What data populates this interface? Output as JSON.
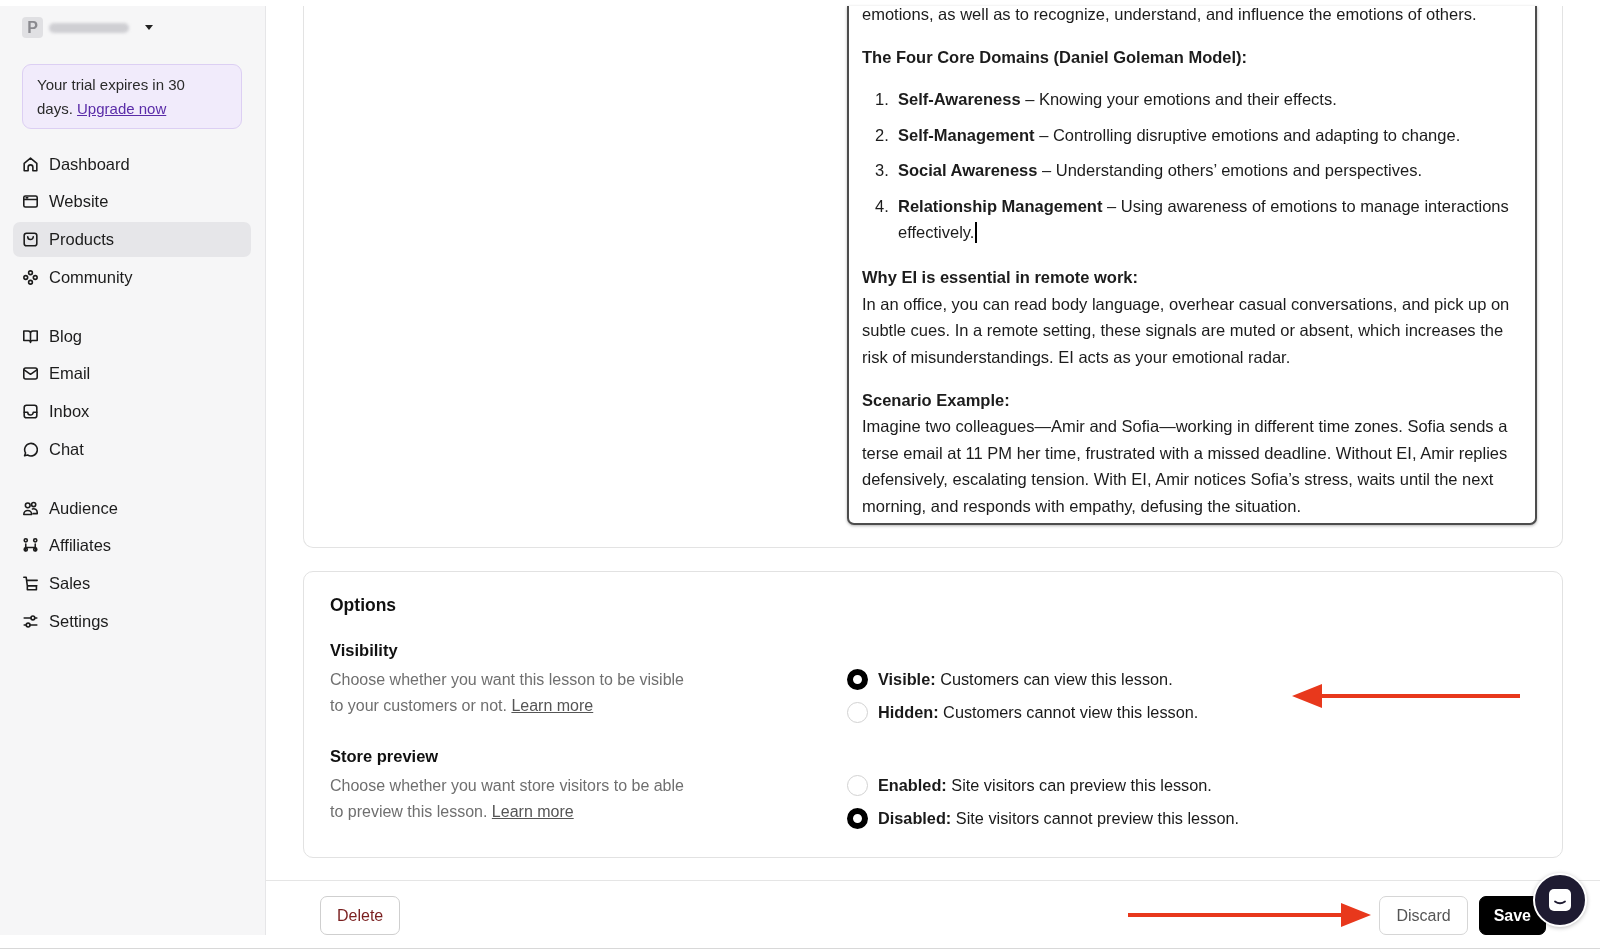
{
  "sidebar": {
    "workspace": {
      "initial": "P"
    },
    "trial_notice": {
      "text": "Your trial expires in 30 days.",
      "link": "Upgrade now"
    },
    "nav_groups": [
      {
        "items": [
          {
            "label": "Dashboard",
            "selected": false
          },
          {
            "label": "Website",
            "selected": false
          },
          {
            "label": "Products",
            "selected": true
          },
          {
            "label": "Community",
            "selected": false
          }
        ]
      },
      {
        "items": [
          {
            "label": "Blog",
            "selected": false
          },
          {
            "label": "Email",
            "selected": false
          },
          {
            "label": "Inbox",
            "selected": false
          },
          {
            "label": "Chat",
            "selected": false
          }
        ]
      },
      {
        "items": [
          {
            "label": "Audience",
            "selected": false
          },
          {
            "label": "Affiliates",
            "selected": false
          },
          {
            "label": "Sales",
            "selected": false
          },
          {
            "label": "Settings",
            "selected": false
          }
        ]
      }
    ]
  },
  "editor": {
    "blocks": [
      {
        "kind": "paragraph",
        "text": "emotions, as well as to recognize, understand, and influence the emotions of others."
      },
      {
        "kind": "heading",
        "text": "The Four Core Domains (Daniel Goleman Model):"
      },
      {
        "kind": "ordered_list",
        "items": [
          {
            "number": "1.",
            "text": "**Self-Awareness** – Knowing your emotions and their effects.",
            "has_cursor": false
          },
          {
            "number": "2.",
            "text": "**Self-Management** – Controlling disruptive emotions and adapting to change.",
            "has_cursor": false
          },
          {
            "number": "3.",
            "text": "**Social Awareness** – Understanding others’ emotions and perspectives.",
            "has_cursor": false
          },
          {
            "number": "4.",
            "text": "**Relationship Management** – Using awareness of emotions to manage interactions effectively.",
            "has_cursor": true
          }
        ]
      },
      {
        "kind": "section",
        "heading": "Why EI is essential in remote work:",
        "text": "In an office, you can read body language, overhear casual conversations, and pick up on subtle cues. In a remote setting, these signals are muted or absent, which increases the risk of misunderstandings. EI acts as your emotional radar."
      },
      {
        "kind": "section",
        "heading": "Scenario Example:",
        "text": "Imagine two colleagues—Amir and Sofia—working in different time zones. Sofia sends a terse email at 11 PM her time, frustrated with a missed deadline. Without EI, Amir replies defensively, escalating tension. With EI, Amir notices Sofia’s stress, waits until the next morning, and responds with empathy, defusing the situation."
      }
    ]
  },
  "options": {
    "title": "Options",
    "settings": [
      {
        "heading": "Visibility",
        "description": "Choose whether you want this lesson to be visible to your customers or not.",
        "link": "Learn more",
        "choices": [
          {
            "label": "**Visible:** Customers can view this lesson.",
            "selected": true
          },
          {
            "label": "**Hidden:** Customers cannot view this lesson.",
            "selected": false
          }
        ]
      },
      {
        "heading": "Store preview",
        "description": "Choose whether you want store visitors to be able to preview this lesson.",
        "link": "Learn more",
        "choices": [
          {
            "label": "**Enabled:** Site visitors can preview this lesson.",
            "selected": false
          },
          {
            "label": "**Disabled:** Site visitors cannot preview this lesson.",
            "selected": true
          }
        ]
      }
    ]
  },
  "footer": {
    "delete_button": "Delete",
    "discard_button": "Discard",
    "save_button": "Save"
  }
}
